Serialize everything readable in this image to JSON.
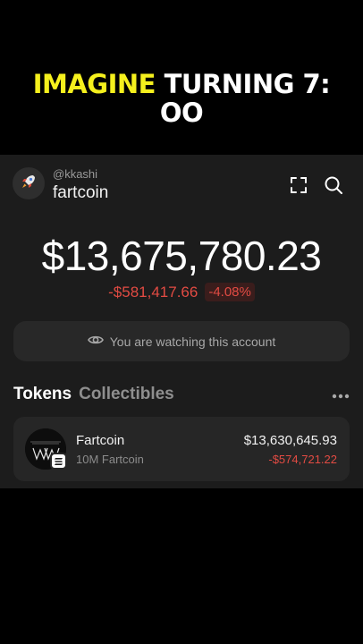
{
  "caption": {
    "line1_highlight": "IMAGINE",
    "line1_rest": " TURNING 7:",
    "line2": "OO"
  },
  "colors": {
    "caption_highlight": "#f5f01d",
    "negative": "#e24b43",
    "background": "#1c1c1c"
  },
  "header": {
    "handle": "@kkashi",
    "account_name": "fartcoin",
    "avatar_icon": "rocket-icon",
    "actions": [
      "scan-icon",
      "search-icon"
    ]
  },
  "portfolio": {
    "balance": "$13,675,780.23",
    "change_amount": "-$581,417.66",
    "change_percent": "-4.08%"
  },
  "watch_banner": {
    "icon": "eye-icon",
    "text": "You are watching this account"
  },
  "tabs": [
    {
      "label": "Tokens",
      "active": true
    },
    {
      "label": "Collectibles",
      "active": false
    }
  ],
  "tokens": [
    {
      "name": "Fartcoin",
      "amount": "10M Fartcoin",
      "value": "$13,630,645.93",
      "change": "-$574,721.22",
      "chain_icon": "solana-icon"
    }
  ]
}
